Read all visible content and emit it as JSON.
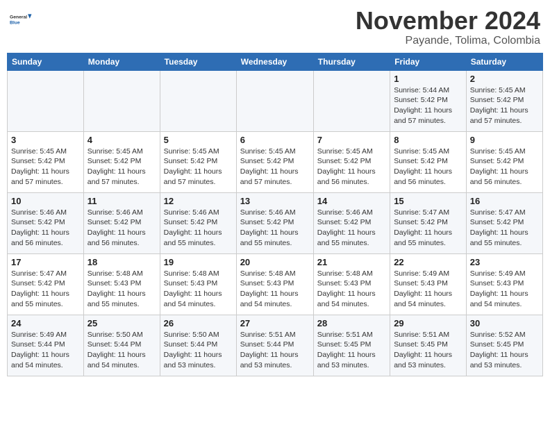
{
  "header": {
    "logo_line1": "General",
    "logo_line2": "Blue",
    "month": "November 2024",
    "location": "Payande, Tolima, Colombia"
  },
  "weekdays": [
    "Sunday",
    "Monday",
    "Tuesday",
    "Wednesday",
    "Thursday",
    "Friday",
    "Saturday"
  ],
  "weeks": [
    [
      {
        "day": "",
        "info": ""
      },
      {
        "day": "",
        "info": ""
      },
      {
        "day": "",
        "info": ""
      },
      {
        "day": "",
        "info": ""
      },
      {
        "day": "",
        "info": ""
      },
      {
        "day": "1",
        "info": "Sunrise: 5:44 AM\nSunset: 5:42 PM\nDaylight: 11 hours and 57 minutes."
      },
      {
        "day": "2",
        "info": "Sunrise: 5:45 AM\nSunset: 5:42 PM\nDaylight: 11 hours and 57 minutes."
      }
    ],
    [
      {
        "day": "3",
        "info": "Sunrise: 5:45 AM\nSunset: 5:42 PM\nDaylight: 11 hours and 57 minutes."
      },
      {
        "day": "4",
        "info": "Sunrise: 5:45 AM\nSunset: 5:42 PM\nDaylight: 11 hours and 57 minutes."
      },
      {
        "day": "5",
        "info": "Sunrise: 5:45 AM\nSunset: 5:42 PM\nDaylight: 11 hours and 57 minutes."
      },
      {
        "day": "6",
        "info": "Sunrise: 5:45 AM\nSunset: 5:42 PM\nDaylight: 11 hours and 57 minutes."
      },
      {
        "day": "7",
        "info": "Sunrise: 5:45 AM\nSunset: 5:42 PM\nDaylight: 11 hours and 56 minutes."
      },
      {
        "day": "8",
        "info": "Sunrise: 5:45 AM\nSunset: 5:42 PM\nDaylight: 11 hours and 56 minutes."
      },
      {
        "day": "9",
        "info": "Sunrise: 5:45 AM\nSunset: 5:42 PM\nDaylight: 11 hours and 56 minutes."
      }
    ],
    [
      {
        "day": "10",
        "info": "Sunrise: 5:46 AM\nSunset: 5:42 PM\nDaylight: 11 hours and 56 minutes."
      },
      {
        "day": "11",
        "info": "Sunrise: 5:46 AM\nSunset: 5:42 PM\nDaylight: 11 hours and 56 minutes."
      },
      {
        "day": "12",
        "info": "Sunrise: 5:46 AM\nSunset: 5:42 PM\nDaylight: 11 hours and 55 minutes."
      },
      {
        "day": "13",
        "info": "Sunrise: 5:46 AM\nSunset: 5:42 PM\nDaylight: 11 hours and 55 minutes."
      },
      {
        "day": "14",
        "info": "Sunrise: 5:46 AM\nSunset: 5:42 PM\nDaylight: 11 hours and 55 minutes."
      },
      {
        "day": "15",
        "info": "Sunrise: 5:47 AM\nSunset: 5:42 PM\nDaylight: 11 hours and 55 minutes."
      },
      {
        "day": "16",
        "info": "Sunrise: 5:47 AM\nSunset: 5:42 PM\nDaylight: 11 hours and 55 minutes."
      }
    ],
    [
      {
        "day": "17",
        "info": "Sunrise: 5:47 AM\nSunset: 5:42 PM\nDaylight: 11 hours and 55 minutes."
      },
      {
        "day": "18",
        "info": "Sunrise: 5:48 AM\nSunset: 5:43 PM\nDaylight: 11 hours and 55 minutes."
      },
      {
        "day": "19",
        "info": "Sunrise: 5:48 AM\nSunset: 5:43 PM\nDaylight: 11 hours and 54 minutes."
      },
      {
        "day": "20",
        "info": "Sunrise: 5:48 AM\nSunset: 5:43 PM\nDaylight: 11 hours and 54 minutes."
      },
      {
        "day": "21",
        "info": "Sunrise: 5:48 AM\nSunset: 5:43 PM\nDaylight: 11 hours and 54 minutes."
      },
      {
        "day": "22",
        "info": "Sunrise: 5:49 AM\nSunset: 5:43 PM\nDaylight: 11 hours and 54 minutes."
      },
      {
        "day": "23",
        "info": "Sunrise: 5:49 AM\nSunset: 5:43 PM\nDaylight: 11 hours and 54 minutes."
      }
    ],
    [
      {
        "day": "24",
        "info": "Sunrise: 5:49 AM\nSunset: 5:44 PM\nDaylight: 11 hours and 54 minutes."
      },
      {
        "day": "25",
        "info": "Sunrise: 5:50 AM\nSunset: 5:44 PM\nDaylight: 11 hours and 54 minutes."
      },
      {
        "day": "26",
        "info": "Sunrise: 5:50 AM\nSunset: 5:44 PM\nDaylight: 11 hours and 53 minutes."
      },
      {
        "day": "27",
        "info": "Sunrise: 5:51 AM\nSunset: 5:44 PM\nDaylight: 11 hours and 53 minutes."
      },
      {
        "day": "28",
        "info": "Sunrise: 5:51 AM\nSunset: 5:45 PM\nDaylight: 11 hours and 53 minutes."
      },
      {
        "day": "29",
        "info": "Sunrise: 5:51 AM\nSunset: 5:45 PM\nDaylight: 11 hours and 53 minutes."
      },
      {
        "day": "30",
        "info": "Sunrise: 5:52 AM\nSunset: 5:45 PM\nDaylight: 11 hours and 53 minutes."
      }
    ]
  ]
}
